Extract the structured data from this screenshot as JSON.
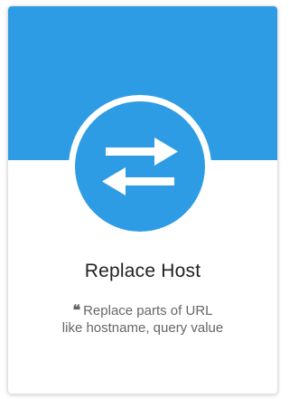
{
  "card": {
    "title": "Replace Host",
    "quote_glyph": "❝",
    "description_line1": "Replace parts of URL",
    "description_line2": "like hostname, query value",
    "icon": "swap-arrows-icon",
    "colors": {
      "accent": "#2d9ce4",
      "title_text": "#222222",
      "description_text": "#666666"
    }
  }
}
